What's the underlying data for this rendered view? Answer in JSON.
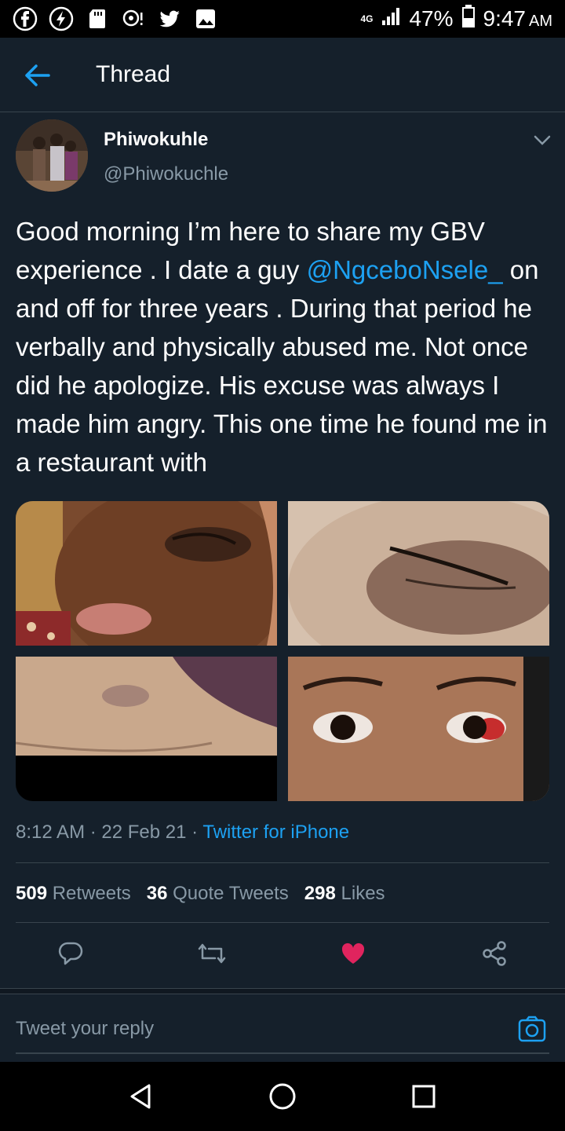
{
  "status_bar": {
    "network": "4G",
    "battery": "47%",
    "time": "9:47",
    "ampm": "AM",
    "icons": [
      "facebook-icon",
      "messenger-icon",
      "sd-card-icon",
      "hotspot-icon",
      "twitter-icon",
      "gallery-icon"
    ]
  },
  "header": {
    "title": "Thread"
  },
  "tweet": {
    "author_name": "Phiwokuhle",
    "author_handle": "@Phiwokuchle",
    "text_before": "Good morning I’m here to share my GBV experience . I date a guy  ",
    "mention": "@NgceboNsele_",
    "text_after": " on and off for three years . During that period he verbally and physically abused me. Not once did he apologize. His excuse was always I made him angry. This one time he found me in a restaurant with",
    "timestamp": "8:12 AM · 22 Feb 21 · ",
    "source": "Twitter for iPhone",
    "stats": {
      "retweets_count": "509",
      "retweets_label": "Retweets",
      "quotes_count": "36",
      "quotes_label": "Quote Tweets",
      "likes_count": "298",
      "likes_label": "Likes"
    }
  },
  "reply": {
    "placeholder": "Tweet your reply"
  },
  "colors": {
    "background": "#15202b",
    "accent": "#1da1f2",
    "like": "#e0245e",
    "muted": "#8899a6"
  }
}
